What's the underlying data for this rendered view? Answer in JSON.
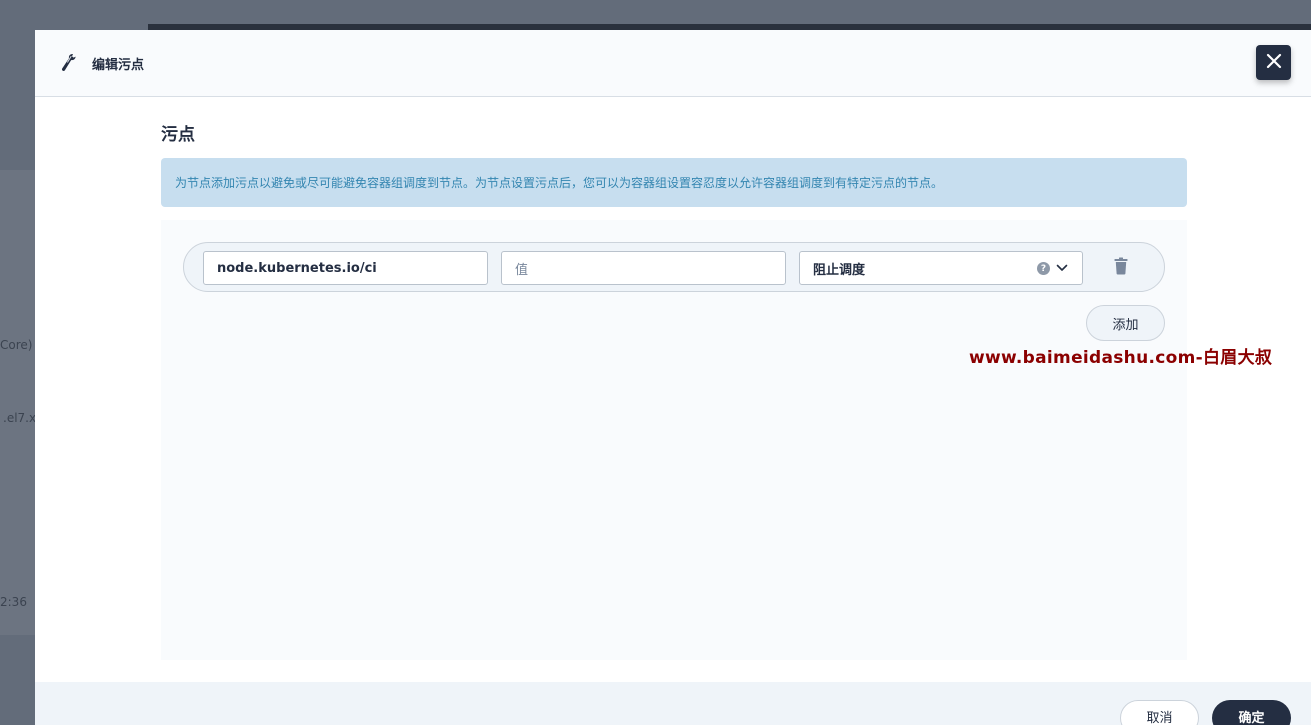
{
  "background": {
    "fragments": [
      "Core)",
      ".el7.x",
      "2:36"
    ]
  },
  "dialog": {
    "title": "编辑污点",
    "section_title": "污点",
    "info": "为节点添加污点以避免或尽可能避免容器组调度到节点。为节点设置污点后，您可以为容器组设置容忍度以允许容器组调度到有特定污点的节点。",
    "taints": [
      {
        "key": "node.kubernetes.io/ci",
        "value": "",
        "value_placeholder": "值",
        "effect": "阻止调度"
      }
    ],
    "add_label": "添加",
    "cancel_label": "取消",
    "ok_label": "确定"
  },
  "watermark": "www.baimeidashu.com-白眉大叔",
  "icons": {
    "header": "wrench-icon",
    "close": "close-icon",
    "help": "question-icon",
    "dropdown": "chevron-down-icon",
    "delete": "trash-icon"
  },
  "colors": {
    "primary": "#242e42",
    "info_bg": "#c7deef",
    "info_text": "#3385b0",
    "watermark": "#8b0000"
  }
}
